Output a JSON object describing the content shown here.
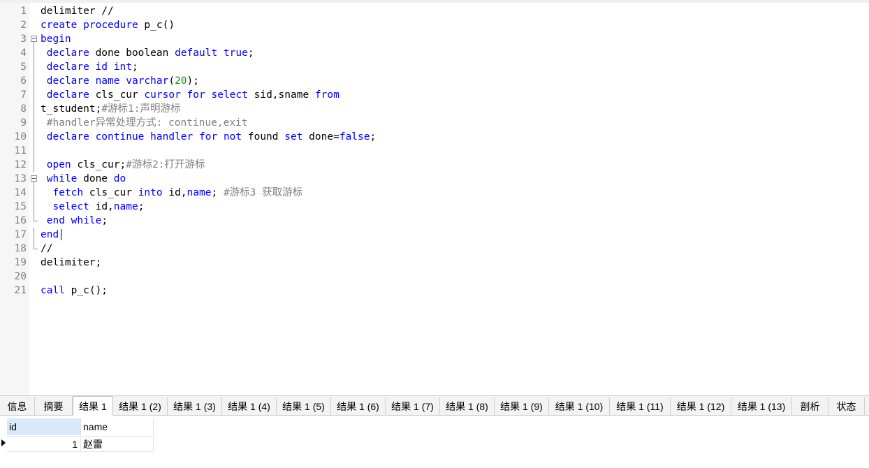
{
  "editor": {
    "lines": [
      {
        "n": "1",
        "tokens": [
          {
            "t": "delimiter //",
            "c": ""
          }
        ]
      },
      {
        "n": "2",
        "tokens": [
          {
            "t": "create",
            "c": "kw"
          },
          {
            "t": " ",
            "c": ""
          },
          {
            "t": "procedure",
            "c": "kw"
          },
          {
            "t": " p_c()",
            "c": ""
          }
        ]
      },
      {
        "n": "3",
        "tokens": [
          {
            "t": "begin",
            "c": "kw"
          }
        ]
      },
      {
        "n": "4",
        "tokens": [
          {
            "t": " ",
            "c": ""
          },
          {
            "t": "declare",
            "c": "kw"
          },
          {
            "t": " done boolean ",
            "c": ""
          },
          {
            "t": "default",
            "c": "kw"
          },
          {
            "t": " ",
            "c": ""
          },
          {
            "t": "true",
            "c": "kw"
          },
          {
            "t": ";",
            "c": ""
          }
        ]
      },
      {
        "n": "5",
        "tokens": [
          {
            "t": " ",
            "c": ""
          },
          {
            "t": "declare",
            "c": "kw"
          },
          {
            "t": " ",
            "c": ""
          },
          {
            "t": "id",
            "c": "kw"
          },
          {
            "t": " ",
            "c": ""
          },
          {
            "t": "int",
            "c": "kw"
          },
          {
            "t": ";",
            "c": ""
          }
        ]
      },
      {
        "n": "6",
        "tokens": [
          {
            "t": " ",
            "c": ""
          },
          {
            "t": "declare",
            "c": "kw"
          },
          {
            "t": " ",
            "c": ""
          },
          {
            "t": "name",
            "c": "kw"
          },
          {
            "t": " ",
            "c": ""
          },
          {
            "t": "varchar",
            "c": "kw"
          },
          {
            "t": "(",
            "c": ""
          },
          {
            "t": "20",
            "c": "num"
          },
          {
            "t": ");",
            "c": ""
          }
        ]
      },
      {
        "n": "7",
        "tokens": [
          {
            "t": " ",
            "c": ""
          },
          {
            "t": "declare",
            "c": "kw"
          },
          {
            "t": " cls_cur ",
            "c": ""
          },
          {
            "t": "cursor",
            "c": "kw"
          },
          {
            "t": " ",
            "c": ""
          },
          {
            "t": "for",
            "c": "kw"
          },
          {
            "t": " ",
            "c": ""
          },
          {
            "t": "select",
            "c": "kw"
          },
          {
            "t": " sid,sname ",
            "c": ""
          },
          {
            "t": "from",
            "c": "kw"
          }
        ]
      },
      {
        "n": "8",
        "tokens": [
          {
            "t": "t_student;",
            "c": ""
          },
          {
            "t": "#游标1:声明游标",
            "c": "cm"
          }
        ]
      },
      {
        "n": "9",
        "tokens": [
          {
            "t": " ",
            "c": ""
          },
          {
            "t": "#handler异常处理方式: continue,exit",
            "c": "cm"
          }
        ]
      },
      {
        "n": "10",
        "tokens": [
          {
            "t": " ",
            "c": ""
          },
          {
            "t": "declare",
            "c": "kw"
          },
          {
            "t": " ",
            "c": ""
          },
          {
            "t": "continue",
            "c": "kw"
          },
          {
            "t": " ",
            "c": ""
          },
          {
            "t": "handler",
            "c": "kw"
          },
          {
            "t": " ",
            "c": ""
          },
          {
            "t": "for",
            "c": "kw"
          },
          {
            "t": " ",
            "c": ""
          },
          {
            "t": "not",
            "c": "kw"
          },
          {
            "t": " found ",
            "c": ""
          },
          {
            "t": "set",
            "c": "kw"
          },
          {
            "t": " done=",
            "c": ""
          },
          {
            "t": "false",
            "c": "kw"
          },
          {
            "t": ";",
            "c": ""
          }
        ]
      },
      {
        "n": "11",
        "tokens": []
      },
      {
        "n": "12",
        "tokens": [
          {
            "t": " ",
            "c": ""
          },
          {
            "t": "open",
            "c": "kw"
          },
          {
            "t": " cls_cur;",
            "c": ""
          },
          {
            "t": "#游标2:打开游标",
            "c": "cm"
          }
        ]
      },
      {
        "n": "13",
        "tokens": [
          {
            "t": " ",
            "c": ""
          },
          {
            "t": "while",
            "c": "kw"
          },
          {
            "t": " done ",
            "c": ""
          },
          {
            "t": "do",
            "c": "kw"
          }
        ]
      },
      {
        "n": "14",
        "tokens": [
          {
            "t": "  ",
            "c": ""
          },
          {
            "t": "fetch",
            "c": "kw"
          },
          {
            "t": " cls_cur ",
            "c": ""
          },
          {
            "t": "into",
            "c": "kw"
          },
          {
            "t": " id,",
            "c": ""
          },
          {
            "t": "name",
            "c": "kw"
          },
          {
            "t": "; ",
            "c": ""
          },
          {
            "t": "#游标3 获取游标",
            "c": "cm"
          }
        ]
      },
      {
        "n": "15",
        "tokens": [
          {
            "t": "  ",
            "c": ""
          },
          {
            "t": "select",
            "c": "kw"
          },
          {
            "t": " id,",
            "c": ""
          },
          {
            "t": "name",
            "c": "kw"
          },
          {
            "t": ";",
            "c": ""
          }
        ]
      },
      {
        "n": "16",
        "tokens": [
          {
            "t": " ",
            "c": ""
          },
          {
            "t": "end",
            "c": "kw"
          },
          {
            "t": " ",
            "c": ""
          },
          {
            "t": "while",
            "c": "kw"
          },
          {
            "t": ";",
            "c": ""
          }
        ]
      },
      {
        "n": "17",
        "tokens": [
          {
            "t": "end",
            "c": "kw"
          }
        ]
      },
      {
        "n": "18",
        "tokens": [
          {
            "t": "//",
            "c": ""
          }
        ]
      },
      {
        "n": "19",
        "tokens": [
          {
            "t": "delimiter;",
            "c": ""
          }
        ]
      },
      {
        "n": "20",
        "tokens": []
      },
      {
        "n": "21",
        "tokens": [
          {
            "t": "call",
            "c": "kw"
          },
          {
            "t": " p_c();",
            "c": ""
          }
        ]
      }
    ]
  },
  "tabs": [
    {
      "label": "信息",
      "active": false
    },
    {
      "label": "摘要",
      "active": false
    },
    {
      "label": "结果 1",
      "active": true
    },
    {
      "label": "结果 1 (2)",
      "active": false
    },
    {
      "label": "结果 1 (3)",
      "active": false
    },
    {
      "label": "结果 1 (4)",
      "active": false
    },
    {
      "label": "结果 1 (5)",
      "active": false
    },
    {
      "label": "结果 1 (6)",
      "active": false
    },
    {
      "label": "结果 1 (7)",
      "active": false
    },
    {
      "label": "结果 1 (8)",
      "active": false
    },
    {
      "label": "结果 1 (9)",
      "active": false
    },
    {
      "label": "结果 1 (10)",
      "active": false
    },
    {
      "label": "结果 1 (11)",
      "active": false
    },
    {
      "label": "结果 1 (12)",
      "active": false
    },
    {
      "label": "结果 1 (13)",
      "active": false
    },
    {
      "label": "剖析",
      "active": false
    },
    {
      "label": "状态",
      "active": false
    }
  ],
  "result": {
    "columns": [
      "id",
      "name"
    ],
    "rows": [
      [
        "1",
        "赵雷"
      ]
    ]
  },
  "colors": {
    "keyword": "#0000ff",
    "number": "#00a000",
    "comment": "#808080",
    "header_selected": "#d9e9f9"
  }
}
